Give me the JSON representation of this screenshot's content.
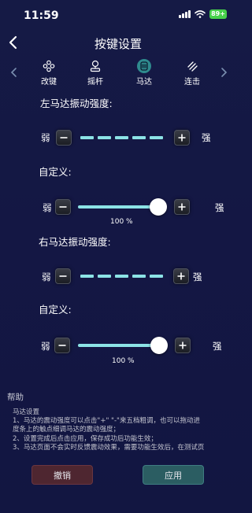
{
  "status": {
    "time": "11:59",
    "battery": "89+"
  },
  "header": {
    "title": "按键设置"
  },
  "tabs": [
    {
      "label": "改键",
      "icon": "gamepad-icon",
      "active": false
    },
    {
      "label": "摇杆",
      "icon": "joystick-icon",
      "active": false
    },
    {
      "label": "马达",
      "icon": "motor-icon",
      "active": true
    },
    {
      "label": "连击",
      "icon": "turbo-icon",
      "active": false
    }
  ],
  "left_motor": {
    "title": "左马达振动强度:",
    "weak": "弱",
    "strong": "强",
    "custom_label": "自定义:",
    "slider_level_percent": 100,
    "slider_value": "100 %",
    "custom_weak": "弱",
    "custom_strong": "强"
  },
  "right_motor": {
    "title": "右马达振动强度:",
    "weak": "弱",
    "strong": "强",
    "custom_label": "自定义:",
    "slider_level_percent": 100,
    "slider_value": "100 %",
    "custom_weak": "弱",
    "custom_strong": "强"
  },
  "help": {
    "title": "帮助",
    "lines": [
      "马达设置",
      "   1、马达的震动强度可以点击\"+\" \"-\"来五档粗调，也可以拖动进",
      "度条上的触点细调马达的震动强度；",
      "   2、设置完成后点击应用，保存成功后功能生效；",
      "   3、马达页面不会实时反馈震动效果，需要功能生效后，在测试页"
    ]
  },
  "buttons": {
    "cancel": "撤销",
    "apply": "应用"
  },
  "colors": {
    "accent": "#8ce3e6",
    "cancel_bg": "#4e2630",
    "apply_bg": "#2b5d62",
    "background": "#151a45"
  }
}
